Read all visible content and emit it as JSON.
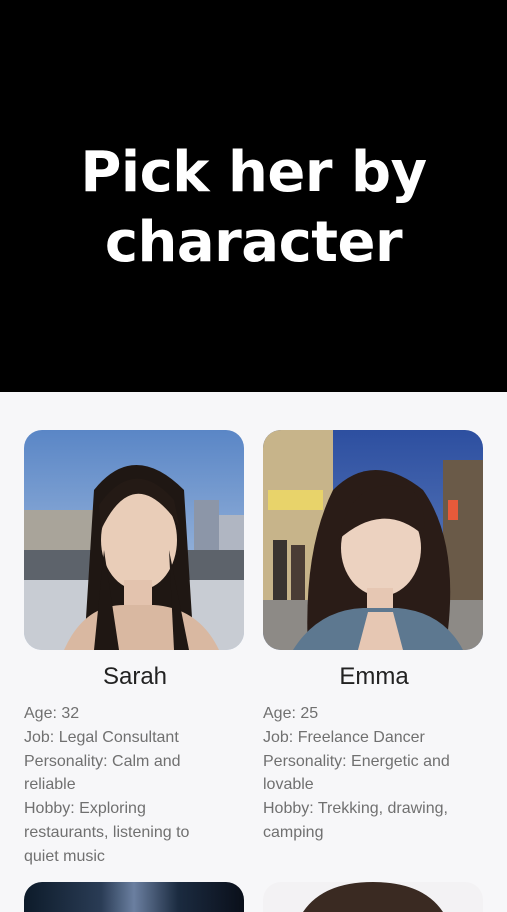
{
  "hero": {
    "title_line1": "Pick her by",
    "title_line2": "character"
  },
  "cards": [
    {
      "name": "Sarah",
      "age": "Age: 32",
      "job": "Job: Legal Consultant",
      "personality_l1": "Personality: Calm and",
      "personality_l2": "reliable",
      "hobby_l1": "Hobby: Exploring",
      "hobby_l2": "restaurants, listening to",
      "hobby_l3": "quiet music"
    },
    {
      "name": "Emma",
      "age": "Age: 25",
      "job": "Job: Freelance Dancer",
      "personality_l1": "Personality: Energetic and",
      "personality_l2": "lovable",
      "hobby_l1": "Hobby: Trekking, drawing,",
      "hobby_l2": "camping"
    }
  ]
}
